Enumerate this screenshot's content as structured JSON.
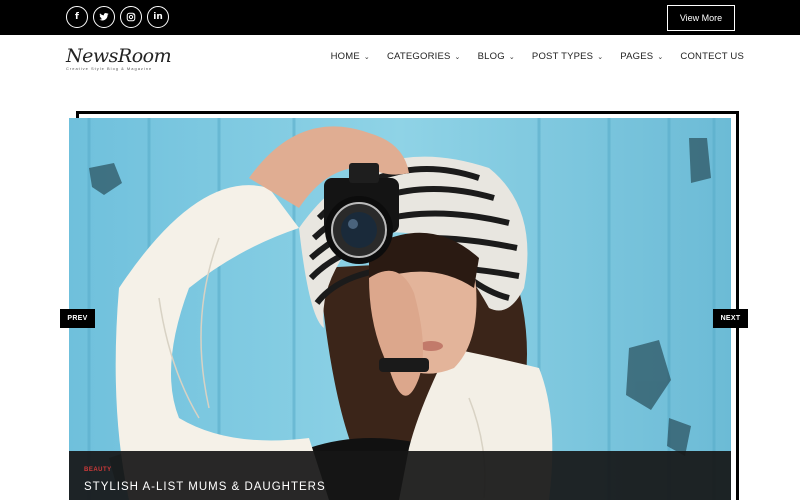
{
  "topbar": {
    "social": [
      {
        "name": "facebook-icon",
        "glyph": "f"
      },
      {
        "name": "twitter-icon",
        "glyph": ""
      },
      {
        "name": "instagram-icon",
        "glyph": ""
      },
      {
        "name": "linkedin-icon",
        "glyph": "in"
      }
    ],
    "view_more_label": "View More"
  },
  "header": {
    "logo_text": "NewsRoom",
    "logo_tagline": "Creative Style Blog & Magazine",
    "nav": [
      {
        "label": "HOME",
        "dropdown": true
      },
      {
        "label": "CATEGORIES",
        "dropdown": true
      },
      {
        "label": "BLOG",
        "dropdown": true
      },
      {
        "label": "POST TYPES",
        "dropdown": true
      },
      {
        "label": "PAGES",
        "dropdown": true
      },
      {
        "label": "CONTECT US",
        "dropdown": false
      }
    ]
  },
  "slider": {
    "prev_label": "PREV",
    "next_label": "NEXT",
    "category": "BEAUTY",
    "title": "STYLISH A-LIST MUMS & DAUGHTERS"
  },
  "colors": {
    "accent": "#d03a3a",
    "bar": "#000000",
    "hero_bg": "#7fc8e0"
  }
}
